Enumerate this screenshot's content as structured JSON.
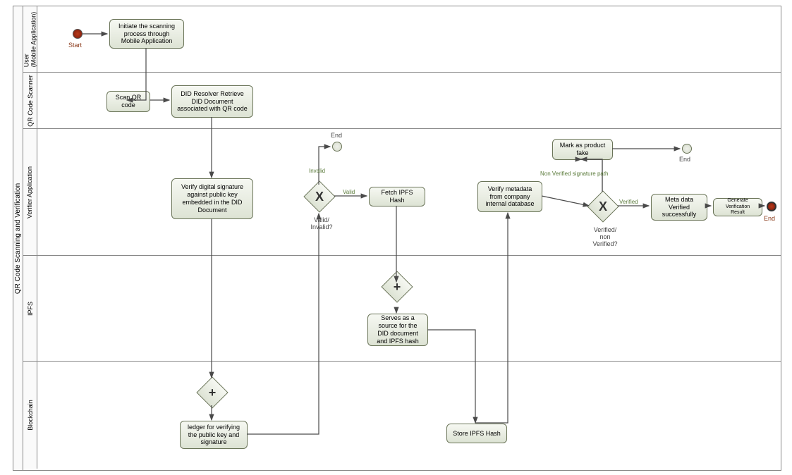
{
  "pool_title": "QR Code Scanning and Verification",
  "lanes": {
    "user": "User\n(Mobile Application)",
    "qr": "QR Code Scanner",
    "verifier": "Verifier Application",
    "ipfs": "IPFS",
    "blockchain": "Blockchain"
  },
  "events": {
    "start_label": "Start",
    "end1_label": "End",
    "end2_label": "End",
    "end3_label": "End"
  },
  "tasks": {
    "initiate": "Initiate the scanning process through Mobile Application",
    "scan_qr": "Scan QR code",
    "did_resolver": "DID Resolver Retrieve DID Document associated with QR code",
    "verify_sig": "Verify digital signature against public key embedded in the DID Document",
    "fetch_hash": "Fetch IPFS Hash",
    "verify_meta": "Verify metadata from company internal database",
    "mark_fake": "Mark as product fake",
    "meta_verified": "Meta data Verified successfully",
    "gen_result": "Generate Verification Result",
    "ipfs_source": "Serves as a source for the DID document and IPFS hash",
    "ledger": "ledger for verifying the public key and signature",
    "store_hash": "Store IPFS Hash"
  },
  "gateways": {
    "valid": "Valid/ Invalid?",
    "verified": "Verified/ non Verified?"
  },
  "edges": {
    "invalid": "Invalid",
    "valid": "Valid",
    "nonverified": "Non Verified signature path",
    "verified": "Verified"
  }
}
